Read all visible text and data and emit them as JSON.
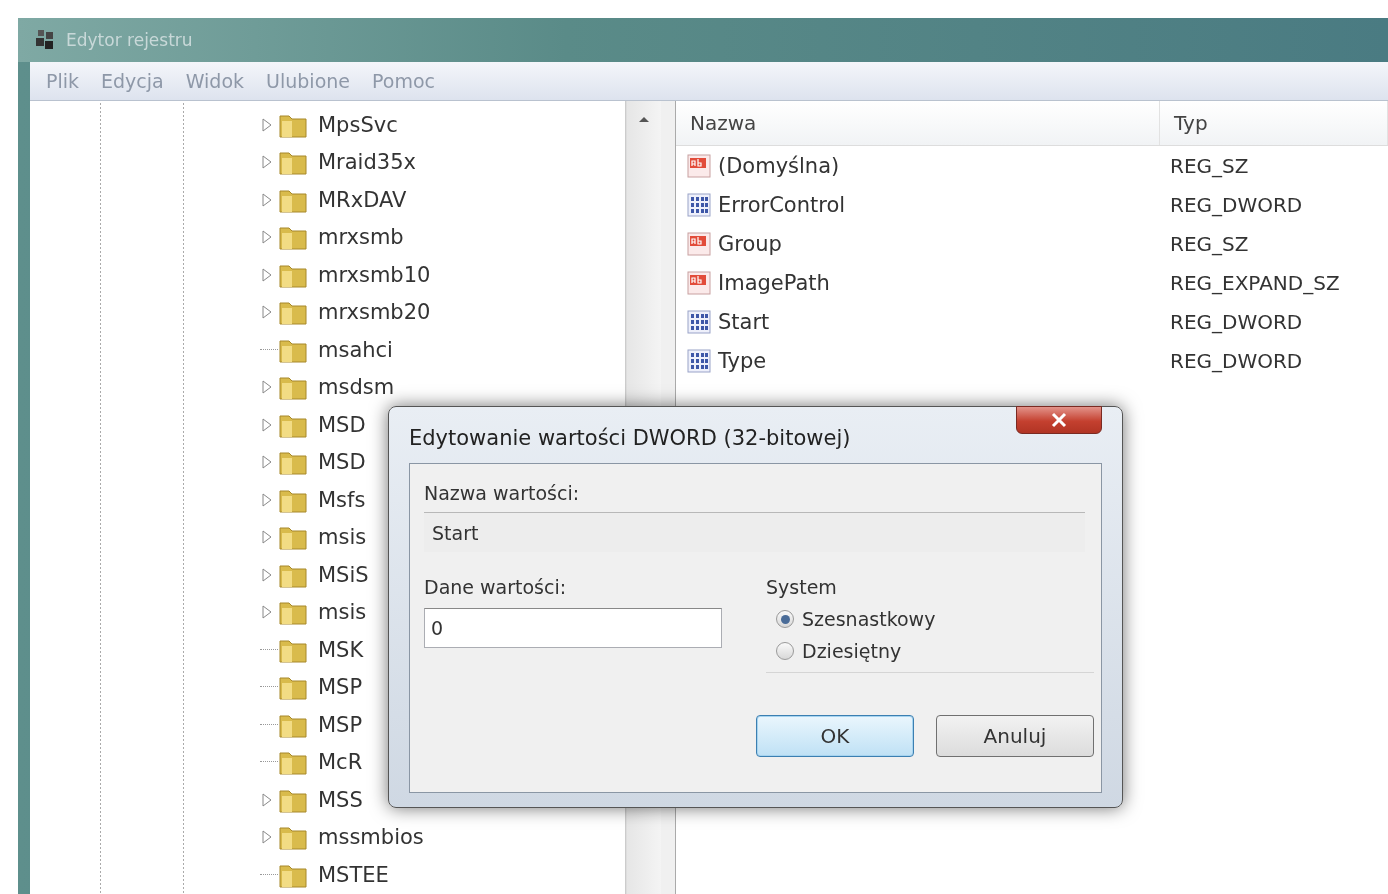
{
  "window": {
    "title": "Edytor rejestru"
  },
  "menu": [
    "Plik",
    "Edycja",
    "Widok",
    "Ulubione",
    "Pomoc"
  ],
  "tree": [
    {
      "label": "MpsSvc",
      "has_children": true
    },
    {
      "label": "Mraid35x",
      "has_children": true
    },
    {
      "label": "MRxDAV",
      "has_children": true
    },
    {
      "label": "mrxsmb",
      "has_children": true
    },
    {
      "label": "mrxsmb10",
      "has_children": true
    },
    {
      "label": "mrxsmb20",
      "has_children": true
    },
    {
      "label": "msahci",
      "has_children": false
    },
    {
      "label": "msdsm",
      "has_children": true
    },
    {
      "label": "MSD",
      "has_children": true
    },
    {
      "label": "MSD",
      "has_children": true
    },
    {
      "label": "Msfs",
      "has_children": true
    },
    {
      "label": "msis",
      "has_children": true
    },
    {
      "label": "MSiS",
      "has_children": true
    },
    {
      "label": "msis",
      "has_children": true
    },
    {
      "label": "MSK",
      "has_children": false
    },
    {
      "label": "MSP",
      "has_children": false
    },
    {
      "label": "MSP",
      "has_children": false
    },
    {
      "label": "McR",
      "has_children": false
    },
    {
      "label": "MSS",
      "has_children": true
    },
    {
      "label": "mssmbios",
      "has_children": true
    },
    {
      "label": "MSTEE",
      "has_children": false
    }
  ],
  "values": {
    "columns": [
      "Nazwa",
      "Typ"
    ],
    "rows": [
      {
        "kind": "string",
        "name": "(Domyślna)",
        "type": "REG_SZ"
      },
      {
        "kind": "number",
        "name": "ErrorControl",
        "type": "REG_DWORD"
      },
      {
        "kind": "string",
        "name": "Group",
        "type": "REG_SZ"
      },
      {
        "kind": "string",
        "name": "ImagePath",
        "type": "REG_EXPAND_SZ"
      },
      {
        "kind": "number",
        "name": "Start",
        "type": "REG_DWORD"
      },
      {
        "kind": "number",
        "name": "Type",
        "type": "REG_DWORD"
      }
    ]
  },
  "dialog": {
    "title": "Edytowanie wartości DWORD (32-bitowej)",
    "name_label": "Nazwa wartości:",
    "name_value": "Start",
    "data_label": "Dane wartości:",
    "data_value": "0",
    "base_label": "System",
    "bases": [
      {
        "label": "Szesnastkowy",
        "selected": true
      },
      {
        "label": "Dziesiętny",
        "selected": false
      }
    ],
    "buttons": [
      {
        "label": "OK",
        "default": true
      },
      {
        "label": "Anuluj",
        "default": false
      }
    ]
  }
}
